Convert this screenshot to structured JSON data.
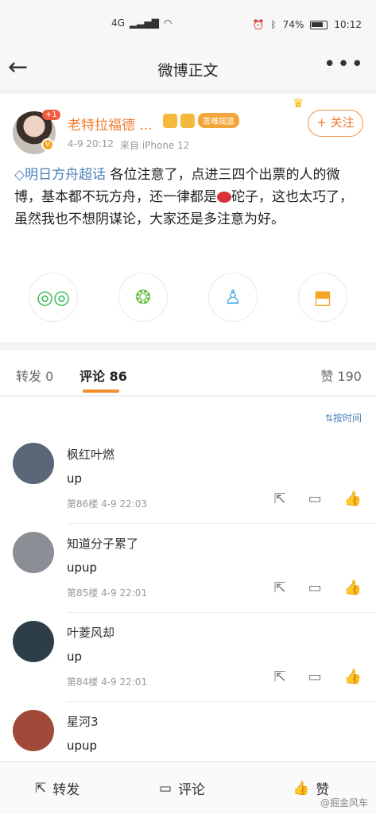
{
  "status_bar": {
    "network": "4G",
    "battery": "74%",
    "time": "10:12"
  },
  "nav": {
    "title": "微博正文"
  },
  "post": {
    "username": "老特拉福德 ...",
    "badge_text": "苦难摇篮",
    "follow_label": "+ 关注",
    "plus_count": "+1",
    "date": "4-9 20:12",
    "source": "来自 iPhone 12",
    "topic": "明日方舟超话",
    "text_part1": " 各位注意了，点进三四个出票的人的微博，基本都不玩方舟，还一律都是",
    "text_part2": "砣子，这也太巧了，虽然我也不想阴谋论，大家还是多注意为好。"
  },
  "tabs": {
    "repost": "转发 0",
    "comment": "评论 86",
    "like": "赞 190"
  },
  "comments": {
    "sort_label": "按时间",
    "items": [
      {
        "name": "枫红叶燃",
        "text": "up",
        "meta": "第86楼 4-9 22:03",
        "avatar_color": "#5a6677"
      },
      {
        "name": "知道分子累了",
        "text": "upup",
        "meta": "第85楼 4-9 22:01",
        "avatar_color": "#8b8f95"
      },
      {
        "name": "叶菱风却",
        "text": "up",
        "meta": "第84楼 4-9 22:01",
        "avatar_color": "#2d3e48"
      },
      {
        "name": "星河3",
        "text": "upup",
        "meta": "",
        "avatar_color": "#a24a3a"
      }
    ]
  },
  "bottom_bar": {
    "repost": "转发",
    "comment": "评论",
    "like": "赞"
  },
  "watermark": "@掘金风车"
}
